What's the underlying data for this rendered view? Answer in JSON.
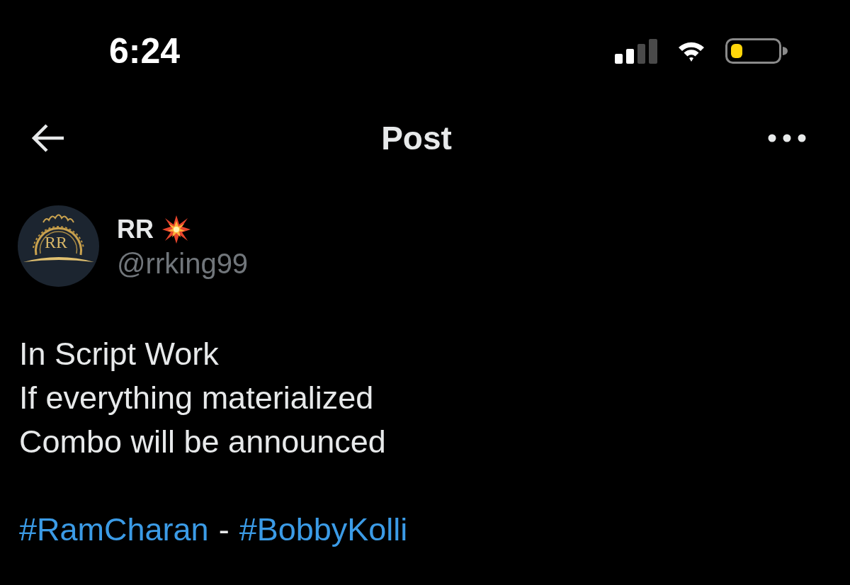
{
  "status_bar": {
    "time": "6:24"
  },
  "header": {
    "title": "Post"
  },
  "post": {
    "author": {
      "name": "RR",
      "handle": "@rrking99",
      "avatar": {
        "monogram": "RR"
      }
    },
    "lines": [
      "In Script Work",
      "If everything materialized",
      "Combo will be announced"
    ],
    "tags": [
      {
        "kind": "hashtag",
        "text": "#RamCharan"
      },
      {
        "kind": "separator",
        "text": "-"
      },
      {
        "kind": "hashtag",
        "text": "#BobbyKolli"
      }
    ]
  }
}
